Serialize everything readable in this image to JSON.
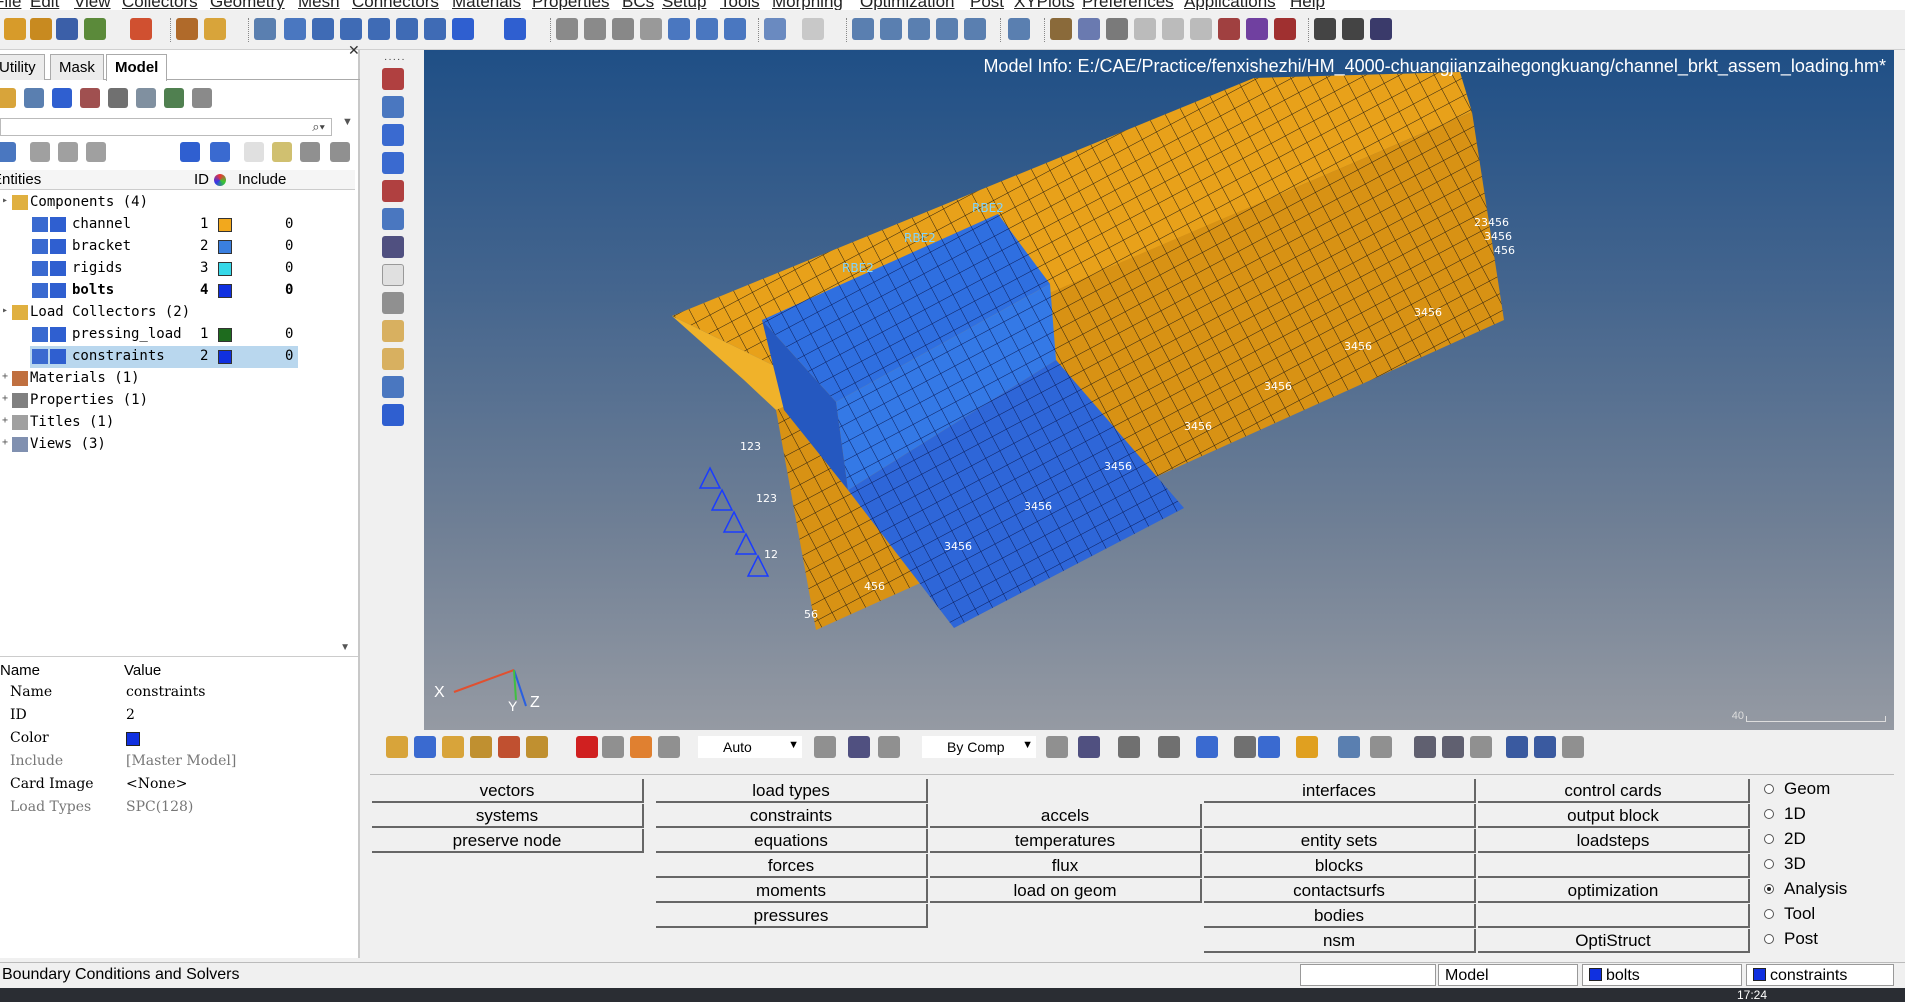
{
  "menubar": {
    "items": [
      "File",
      "Edit",
      "View",
      "Collectors",
      "Geometry",
      "Mesh",
      "Connectors",
      "Materials",
      "Properties",
      "BCs",
      "Setup",
      "Tools",
      "Morphing",
      "Optimization",
      "Post",
      "XYPlots",
      "Preferences",
      "Applications",
      "Help"
    ]
  },
  "left_panel": {
    "tabs": [
      "Utility",
      "Mask",
      "Model"
    ],
    "active_tab": "Model",
    "tree_columns": {
      "entities": "Entities",
      "id": "ID",
      "include": "Include"
    },
    "tree": [
      {
        "label": "Components (4)",
        "level": 0,
        "expander": "-"
      },
      {
        "label": "channel",
        "level": 1,
        "id": "1",
        "color": "#f2a81d",
        "include": "0"
      },
      {
        "label": "bracket",
        "level": 1,
        "id": "2",
        "color": "#3a7fe0",
        "include": "0"
      },
      {
        "label": "rigids",
        "level": 1,
        "id": "3",
        "color": "#36d8e8",
        "include": "0"
      },
      {
        "label": "bolts",
        "level": 1,
        "id": "4",
        "color": "#1030e0",
        "include": "0",
        "bold": true
      },
      {
        "label": "Load Collectors (2)",
        "level": 0,
        "expander": "-"
      },
      {
        "label": "pressing_load",
        "level": 1,
        "id": "1",
        "color": "#1e6b1e",
        "include": "0"
      },
      {
        "label": "constraints",
        "level": 1,
        "id": "2",
        "color": "#1030e0",
        "include": "0",
        "selected": true
      },
      {
        "label": "Materials (1)",
        "level": 0,
        "expander": "+"
      },
      {
        "label": "Properties (1)",
        "level": 0,
        "expander": "+"
      },
      {
        "label": "Titles (1)",
        "level": 0,
        "expander": "+"
      },
      {
        "label": "Views (3)",
        "level": 0,
        "expander": "+"
      }
    ],
    "props_columns": {
      "name": "Name",
      "value": "Value"
    },
    "props": [
      {
        "name": "Name",
        "value": "constraints"
      },
      {
        "name": "ID",
        "value": "2"
      },
      {
        "name": "Color",
        "value": "",
        "swatch": "#1030e0"
      },
      {
        "name": "Include",
        "value": "[Master Model]",
        "dim": true
      },
      {
        "name": "Card Image",
        "value": "<None>"
      },
      {
        "name": "Load Types",
        "value": "SPC(128)",
        "dim": true
      }
    ]
  },
  "viewport": {
    "model_info": "Model Info: E:/CAE/Practice/fenxishezhi/HM_4000-chuangjianzaihegongkuang/channel_brkt_assem_loading.hm*",
    "axes": {
      "x": "X",
      "y": "Y",
      "z": "Z"
    },
    "scale_label": "40",
    "colors": {
      "channel": "#e8a11a",
      "bracket": "#2f6fe0",
      "mesh_line": "#2b2010"
    }
  },
  "bottom_toolbar": {
    "auto_combo": "Auto",
    "bycomp_combo": "By Comp"
  },
  "panel": {
    "columns": [
      [
        "vectors",
        "systems",
        "preserve node",
        "",
        "",
        ""
      ],
      [
        "load types",
        "constraints",
        "equations",
        "forces",
        "moments",
        "pressures"
      ],
      [
        "",
        "accels",
        "temperatures",
        "flux",
        "load on geom",
        ""
      ],
      [
        "interfaces",
        "",
        "entity sets",
        "blocks",
        "contactsurfs",
        "bodies",
        "nsm"
      ],
      [
        "control cards",
        "output block",
        "loadsteps",
        "",
        "optimization",
        "",
        "OptiStruct"
      ]
    ],
    "radios": [
      {
        "label": "Geom",
        "checked": false
      },
      {
        "label": "1D",
        "checked": false
      },
      {
        "label": "2D",
        "checked": false
      },
      {
        "label": "3D",
        "checked": false
      },
      {
        "label": "Analysis",
        "checked": true
      },
      {
        "label": "Tool",
        "checked": false
      },
      {
        "label": "Post",
        "checked": false
      }
    ]
  },
  "statusbar": {
    "message": "Boundary Conditions and Solvers",
    "model": "Model",
    "component": "bolts",
    "component_color": "#1030e0",
    "load_collector": "constraints",
    "load_collector_color": "#1030e0"
  },
  "taskbar": {
    "clock": "17:24"
  }
}
